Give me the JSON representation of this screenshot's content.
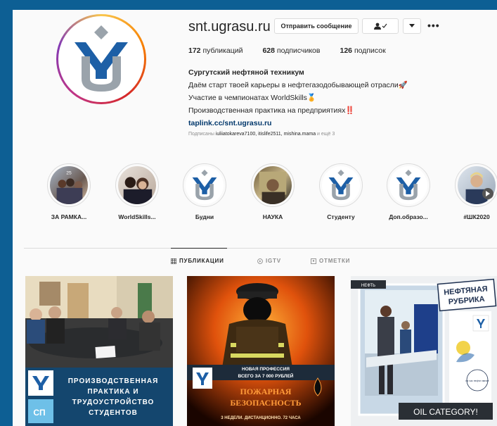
{
  "profile": {
    "username": "snt.ugrasu.ru",
    "message_button": "Отправить сообщение",
    "more_symbol": "•••",
    "stats": [
      {
        "count": "172",
        "label": "публикаций"
      },
      {
        "count": "628",
        "label": "подписчиков"
      },
      {
        "count": "126",
        "label": "подписок"
      }
    ],
    "bio": {
      "name": "Сургутский нефтяной техникум",
      "line1": "Даём старт твоей карьеры в нефтегазодобывающей отрасли🚀",
      "line2": "Участие в чемпионатах WorldSkills🏅",
      "line3": "Производственная практика на предприятиях‼️",
      "link": "taplink.cc/snt.ugrasu.ru"
    },
    "followed_by": {
      "prefix": "Подписаны",
      "names": "iuliiatokareva7100, itislife2511, mishina.mama",
      "suffix": "и ещё 3"
    }
  },
  "highlights": [
    {
      "label": "ЗА РАМКА..."
    },
    {
      "label": "WorldSkills..."
    },
    {
      "label": "Будни"
    },
    {
      "label": "НАУКА"
    },
    {
      "label": "Студенту"
    },
    {
      "label": "Доп.образо..."
    },
    {
      "label": "#ШК2020"
    }
  ],
  "tabs": [
    {
      "label": "ПУБЛИКАЦИИ",
      "icon": "grid-icon"
    },
    {
      "label": "IGTV",
      "icon": "igtv-icon"
    },
    {
      "label": "ОТМЕТКИ",
      "icon": "tag-icon"
    }
  ],
  "posts": {
    "p1": {
      "line1": "ПРОИЗВОДСТВЕННАЯ",
      "line2": "ПРАКТИКА И",
      "line3": "ТРУДОУСТРОЙСТВО",
      "line4": "СТУДЕНТОВ"
    },
    "p2": {
      "line1": "НОВАЯ ПРОФЕССИЯ",
      "line2": "ВСЕГО ЗА 7 000 РУБЛЕЙ",
      "line3": "ПОЖАРНАЯ",
      "line4": "БЕЗОПАСНОСТЬ",
      "line5": "3 НЕДЕЛИ. ДИСТАНЦИОННО. 72 ЧАСА"
    },
    "p3": {
      "title1": "НЕФТЯНАЯ",
      "title2": "РУБРИКА",
      "tag": "НЕФТЬ",
      "bottom": "OIL CATEGORY!",
      "badge": "на час нефти хватит"
    }
  },
  "colors": {
    "background": "#0d5f94",
    "logo_blue": "#1d5fa6",
    "logo_gray": "#9aa3ab",
    "link": "#00376b"
  }
}
